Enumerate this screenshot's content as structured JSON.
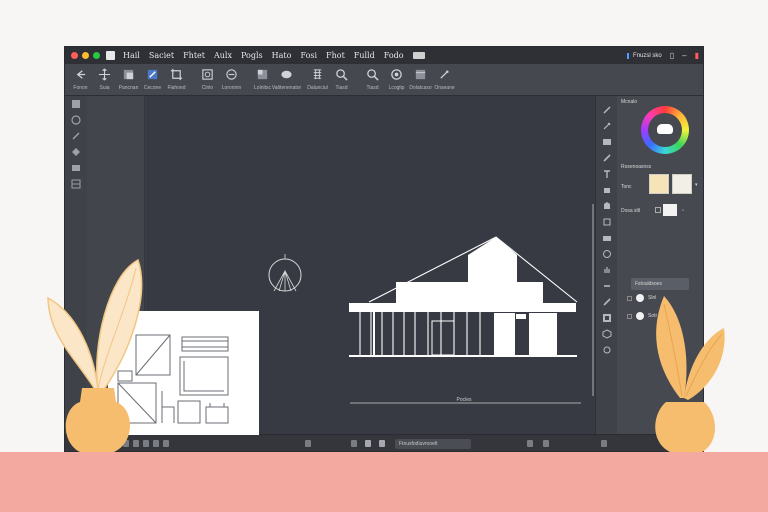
{
  "window": {
    "traffic_colors": [
      "#ff5f57",
      "#febc2e",
      "#28c840"
    ]
  },
  "menubar": {
    "items": [
      "Hail",
      "Saciet",
      "Fhtet",
      "Aulx",
      "Pogls",
      "Hato",
      "Fosi",
      "Fhot",
      "Fulld",
      "Fodo"
    ],
    "doc_name": "Fnuzsl sko"
  },
  "toolbar": {
    "tools": [
      {
        "icon": "arrow-left-icon",
        "label": "Fonon"
      },
      {
        "icon": "move-icon",
        "label": "Suia"
      },
      {
        "icon": "shape-icon",
        "label": "Pancnan"
      },
      {
        "icon": "brush-icon",
        "label": "Cecone"
      },
      {
        "icon": "crop-icon",
        "label": "Flahoed"
      },
      {
        "icon": "transform-icon",
        "label": "Clnlo"
      },
      {
        "icon": "layers-icon",
        "label": "Loroninn"
      },
      {
        "icon": "shape-tool-icon",
        "label": "Lolnitsc"
      },
      {
        "icon": "grid-icon",
        "label": "Vatitenenator"
      },
      {
        "icon": "zoom-icon",
        "label": "Dalunciul"
      },
      {
        "icon": "search-icon",
        "label": "Tiasd"
      },
      {
        "icon": "target-icon",
        "label": "Lcoglip"
      },
      {
        "icon": "window-icon",
        "label": "Dolatcaso"
      },
      {
        "icon": "pen-icon",
        "label": "Onseane"
      }
    ]
  },
  "canvas": {
    "dimension_label": "Pocles"
  },
  "right_panel": {
    "color_title": "Mcnalo",
    "swatches_title": "Rosenoasnss",
    "swatch_label": "Tonc",
    "size_label": "Dosa sltl",
    "button_label": "Fstouldsoes",
    "option1": "Slnl",
    "option2": "Sotr"
  },
  "statusbar": {
    "field": "Ftnusfodiuvrooelt"
  },
  "colors": {
    "app_bg": "#3b3e45",
    "canvas_bg": "#373a42",
    "floor": "#f4a9a0",
    "plant": "#f7bd6e",
    "accent": "#4aa3ff"
  }
}
